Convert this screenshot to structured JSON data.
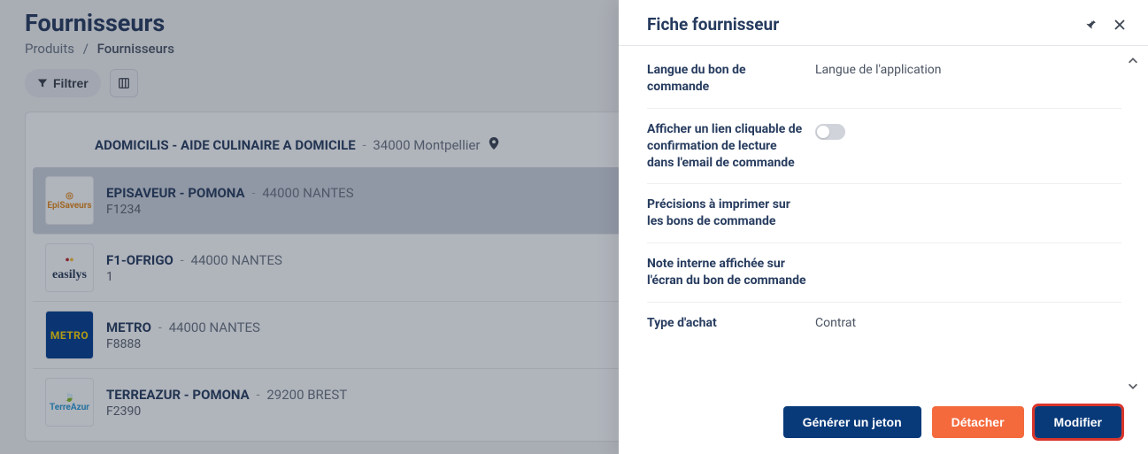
{
  "page": {
    "title": "Fournisseurs"
  },
  "breadcrumb": {
    "parent": "Produits",
    "current": "Fournisseurs"
  },
  "toolbar": {
    "filter_label": "Filtrer"
  },
  "list": {
    "header": {
      "name": "ADOMICILIS - AIDE CULINAIRE A DOMICILE",
      "city": "34000 Montpellier"
    },
    "rows": [
      {
        "name": "EPISAVEUR - POMONA",
        "city": "44000 NANTES",
        "code": "F1234",
        "logo": "episaveur",
        "selected": true
      },
      {
        "name": "F1-OFRIGO",
        "city": "44000 NANTES",
        "code": "1",
        "logo": "easilys",
        "selected": false
      },
      {
        "name": "METRO",
        "city": "44000 NANTES",
        "code": "F8888",
        "logo": "metro",
        "selected": false
      },
      {
        "name": "TERREAZUR - POMONA",
        "city": "29200 BREST",
        "code": "F2390",
        "logo": "terreazur",
        "selected": false
      }
    ]
  },
  "panel": {
    "title": "Fiche fournisseur",
    "fields": {
      "order_lang_label": "Langue du bon de commande",
      "order_lang_value": "Langue de l'application",
      "clickable_link_label": "Afficher un lien cliquable de confirmation de lecture dans l'email de commande",
      "precisions_label": "Précisions à imprimer sur les bons de commande",
      "internal_note_label": "Note interne affichée sur l'écran du bon de commande",
      "purchase_type_label": "Type d'achat",
      "purchase_type_value": "Contrat"
    },
    "footer": {
      "generate_token": "Générer un jeton",
      "detach": "Détacher",
      "modify": "Modifier"
    }
  }
}
